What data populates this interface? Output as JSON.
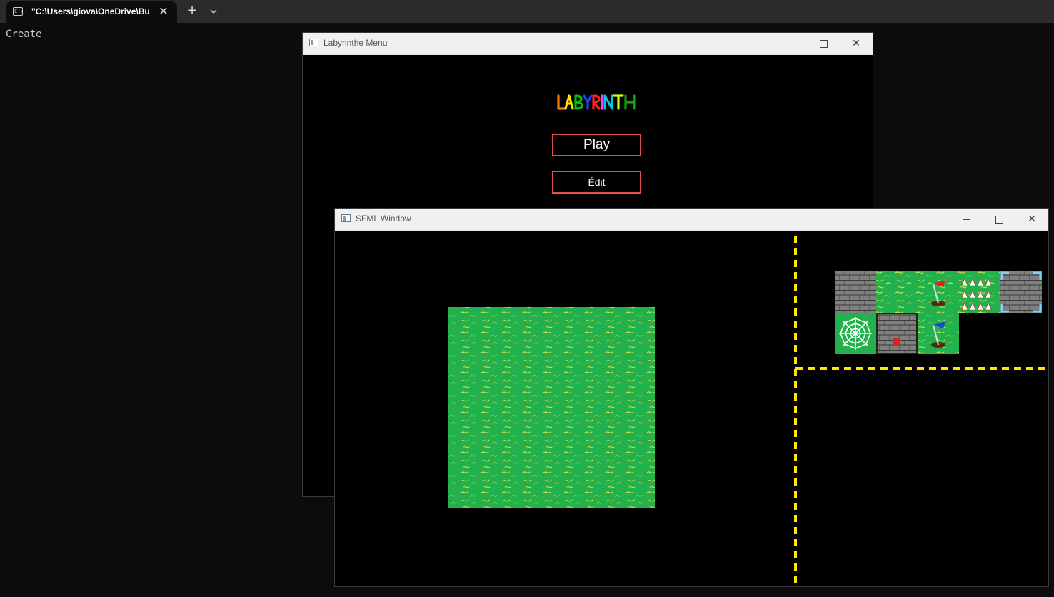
{
  "terminal": {
    "tab_title": "\"C:\\Users\\giova\\OneDrive\\Bu",
    "tab_close": "✕",
    "new_tab": "+",
    "dropdown": "⌄",
    "output_line": "Create"
  },
  "menu_window": {
    "title": "Labyrinthe Menu",
    "logo_text": "LABYRINTH",
    "play_label": "Play",
    "edit_label": "Édit",
    "controls": {
      "close": "✕"
    }
  },
  "sfml_window": {
    "title": "SFML Window",
    "controls": {
      "close": "✕"
    },
    "palette_tiles": [
      "wall",
      "grass",
      "red-flag",
      "spikes",
      "wall-selected",
      "spider-web",
      "button-wall",
      "blue-flag"
    ]
  },
  "colors": {
    "grass": "#22b14c",
    "grass_blade": "#f5e94a",
    "wall": "#7f7f7f",
    "divider": "#ffe600",
    "button_border": "#e05050",
    "selection": "#7fd3f0"
  }
}
